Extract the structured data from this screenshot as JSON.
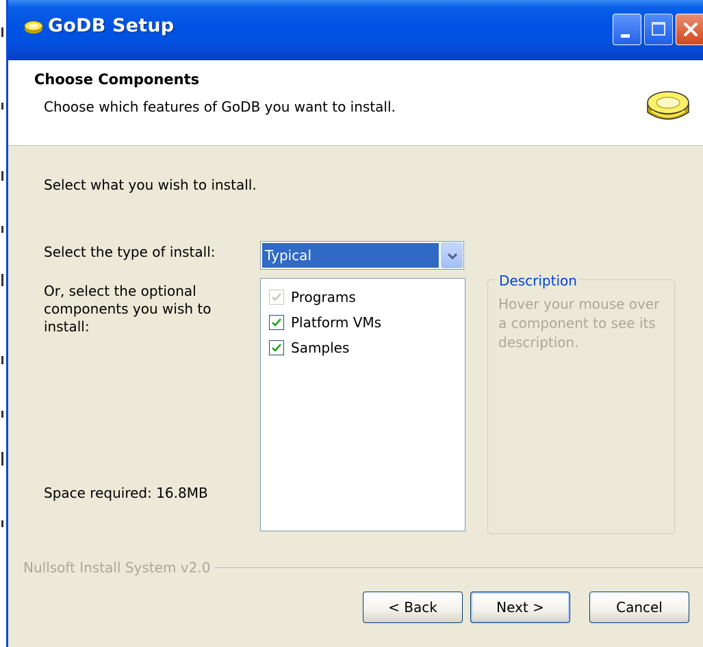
{
  "window": {
    "title": "GoDB Setup",
    "title_icon": "godb-app-icon",
    "controls": [
      "minimize-icon",
      "maximize-icon",
      "close-icon"
    ]
  },
  "header": {
    "title": "Choose Components",
    "subtitle": "Choose which features of GoDB you want to install.",
    "icon": "godb-logo-icon"
  },
  "body": {
    "intro": "Select what you wish to install.",
    "install_type_label": "Select the type of install:",
    "install_type_value": "Typical",
    "optional_label": "Or, select the optional components you wish to install:",
    "space_required": "Space required: 16.8MB",
    "components": [
      {
        "label": "Programs",
        "checked": true,
        "disabled": true
      },
      {
        "label": "Platform VMs",
        "checked": true,
        "disabled": false
      },
      {
        "label": "Samples",
        "checked": true,
        "disabled": false
      }
    ],
    "description": {
      "legend": "Description",
      "text": "Hover your mouse over a component to see its description."
    }
  },
  "footer": {
    "brand": "Nullsoft Install System v2.0",
    "back_label": "< Back",
    "next_label": "Next >",
    "cancel_label": "Cancel"
  },
  "colors": {
    "titlebar": "#0054e3",
    "dialog_bg": "#ece9d8",
    "selection": "#316ac5",
    "checkmark": "#21a121",
    "legend_text": "#0046d5",
    "disabled_text": "#aca899"
  }
}
